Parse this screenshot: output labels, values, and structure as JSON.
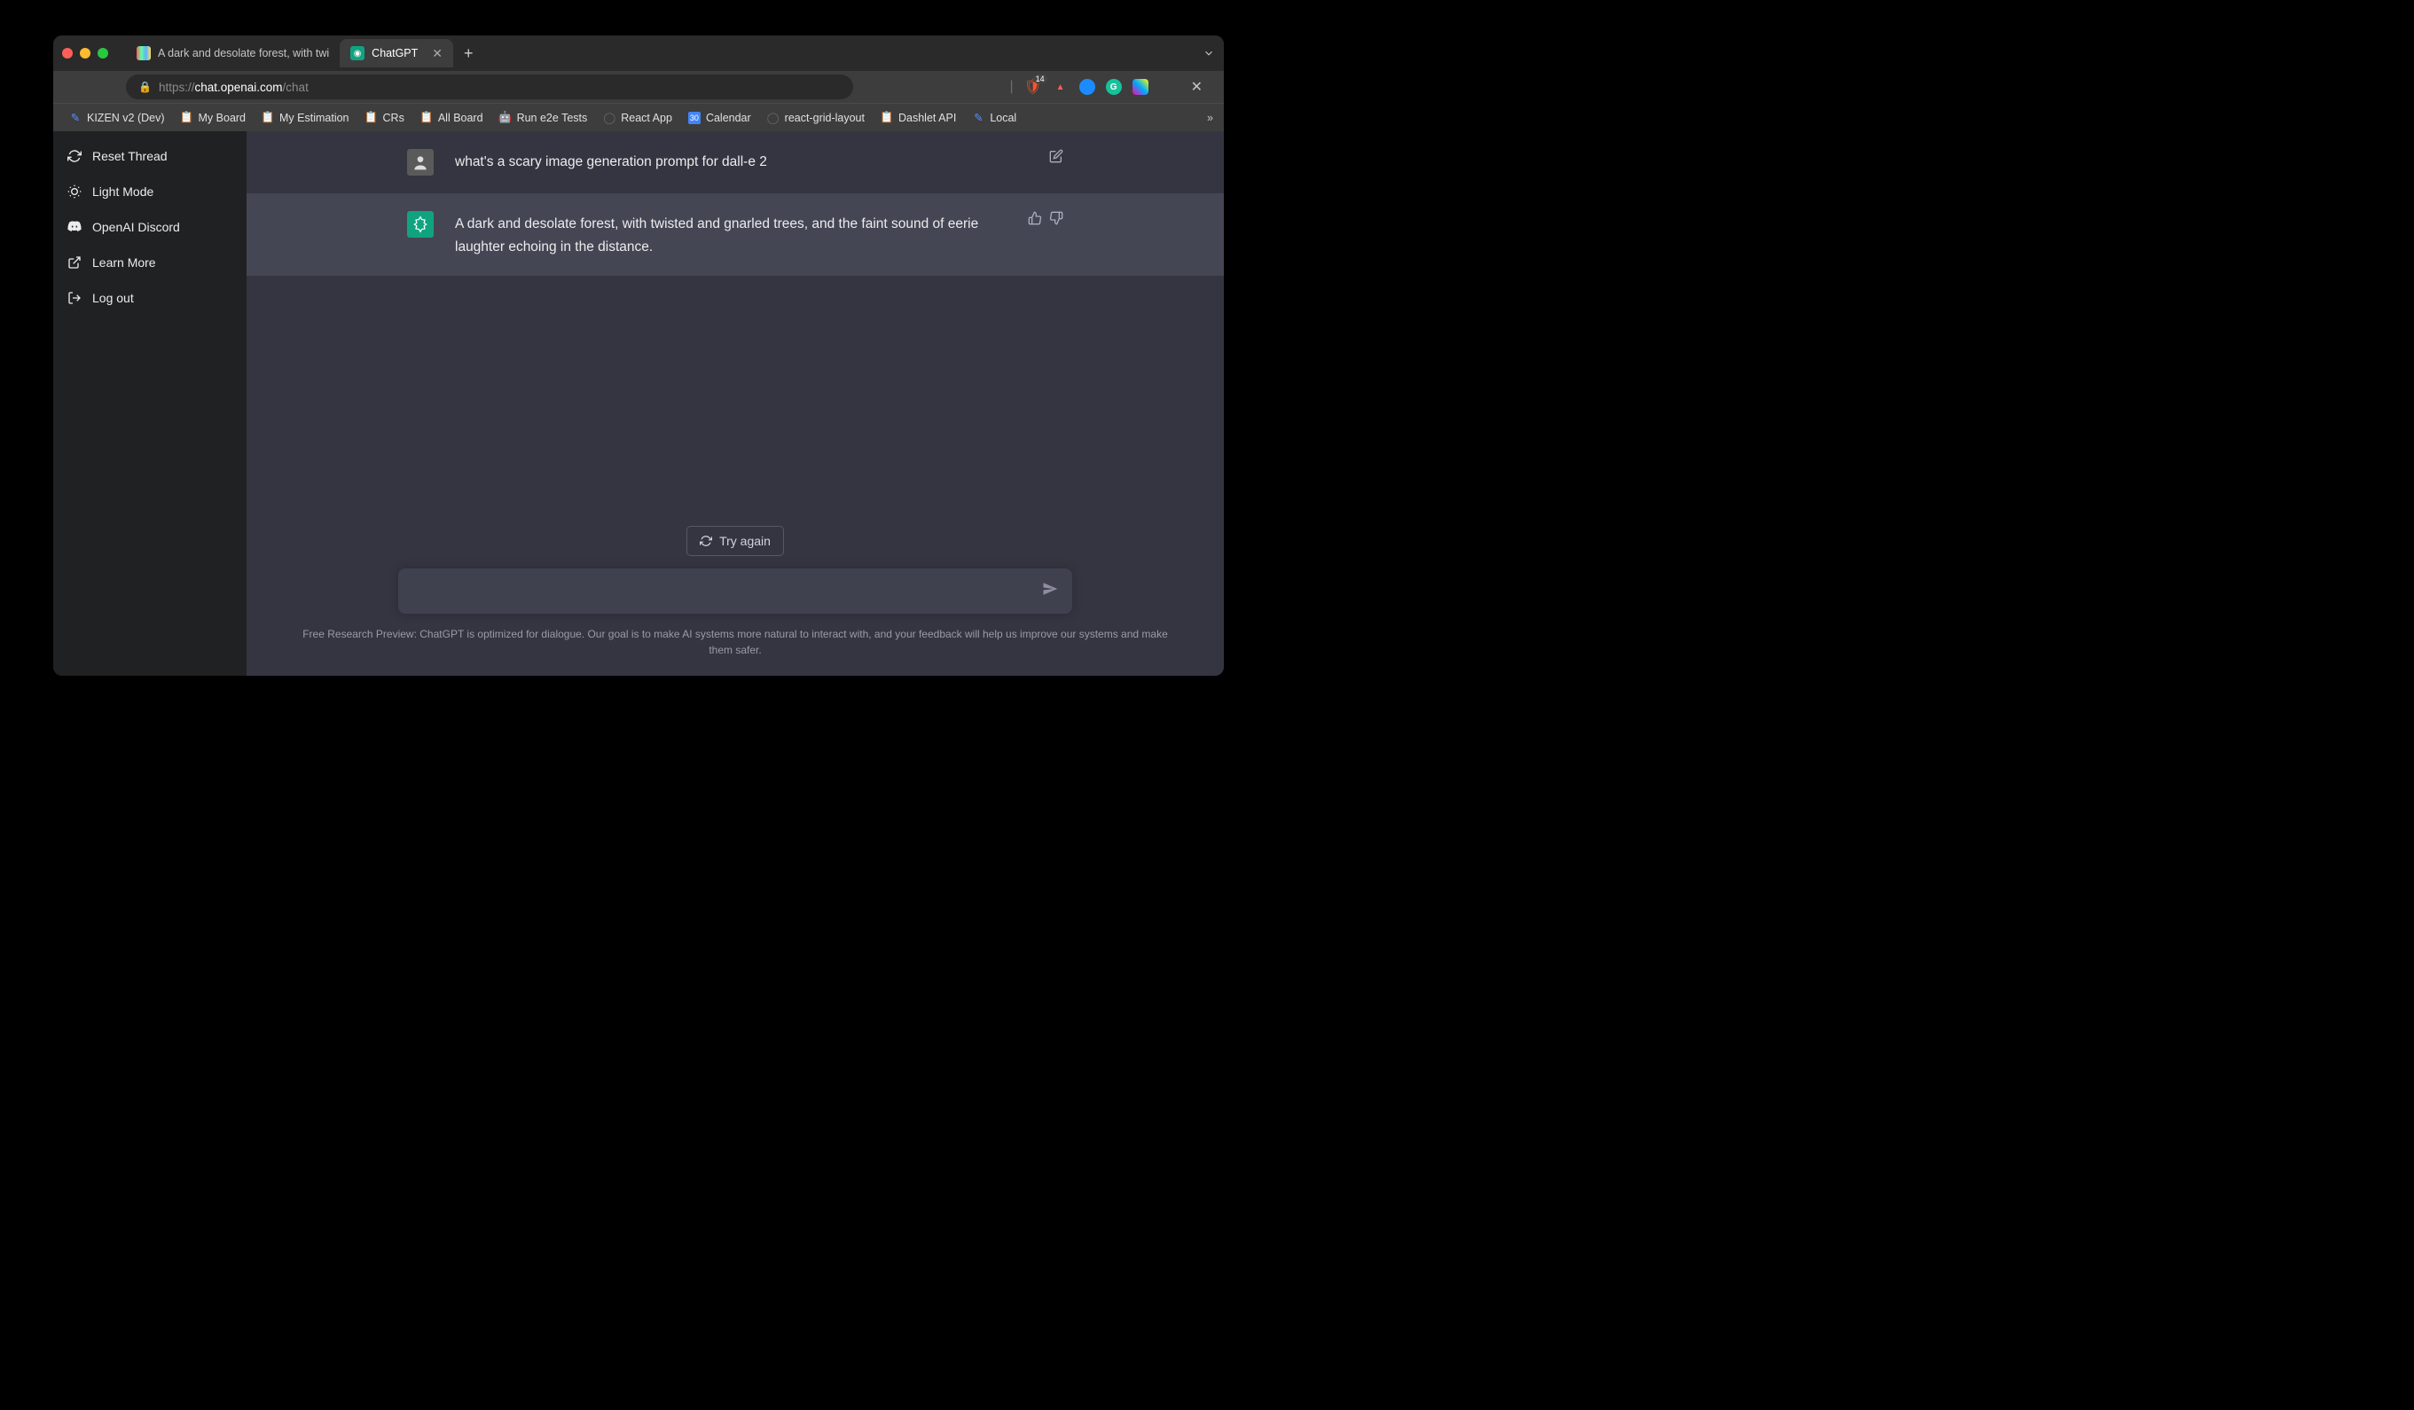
{
  "tabs": [
    {
      "title": "A dark and desolate forest, with twi",
      "active": false
    },
    {
      "title": "ChatGPT",
      "active": true
    }
  ],
  "url": {
    "scheme": "https://",
    "host": "chat.openai.com",
    "path": "/chat"
  },
  "brave_count": "14",
  "bookmarks": [
    "KIZEN v2 (Dev)",
    "My Board",
    "My Estimation",
    "CRs",
    "All Board",
    "Run e2e Tests",
    "React App",
    "Calendar",
    "react-grid-layout",
    "Dashlet API",
    "Local"
  ],
  "sidebar": {
    "reset": "Reset Thread",
    "lightmode": "Light Mode",
    "discord": "OpenAI Discord",
    "learnmore": "Learn More",
    "logout": "Log out"
  },
  "conversation": {
    "user_msg": "what's a scary image generation prompt for dall-e 2",
    "assistant_msg": "A dark and desolate forest, with twisted and gnarled trees, and the faint sound of eerie laughter echoing in the distance."
  },
  "tryagain_label": "Try again",
  "composer_placeholder": "",
  "disclaimer": "Free Research Preview: ChatGPT is optimized for dialogue. Our goal is to make AI systems more natural to interact with, and your feedback will help us improve our systems and make them safer."
}
